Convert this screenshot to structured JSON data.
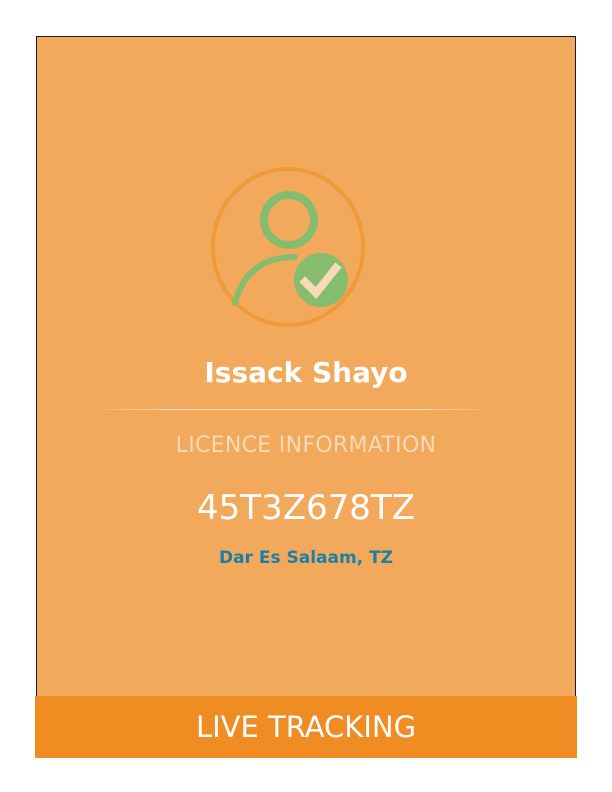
{
  "profile": {
    "name": "Issack Shayo",
    "avatar_icon": "verified-user-icon"
  },
  "licence": {
    "section_label": "LICENCE INFORMATION",
    "number": "45T3Z678TZ",
    "location": "Dar Es Salaam, TZ"
  },
  "actions": {
    "live_tracking_label": "LIVE TRACKING"
  },
  "colors": {
    "card_background": "#f2a95b",
    "button_background": "#ef8c22",
    "avatar_ring": "#ee9a3a",
    "avatar_user": "#86bc6e",
    "location_text": "#1c7fa8"
  }
}
